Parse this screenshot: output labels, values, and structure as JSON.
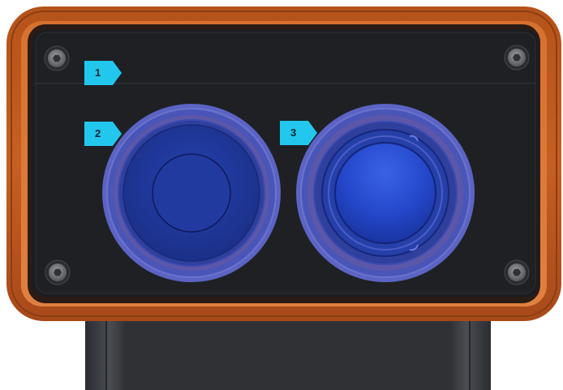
{
  "callouts": [
    {
      "label": "1"
    },
    {
      "label": "2"
    },
    {
      "label": "3"
    }
  ],
  "icons": [
    "hex-socket-screw-icon",
    "hex-socket-screw-icon",
    "hex-socket-screw-icon",
    "hex-socket-screw-icon"
  ],
  "colors": {
    "enclosure": "#c0591d",
    "faceplate": "#1b1d20",
    "button_ring": "#5b64c4",
    "button_cap": "#1f3aa6",
    "callout": "#22c7ee",
    "base": "#303236"
  }
}
